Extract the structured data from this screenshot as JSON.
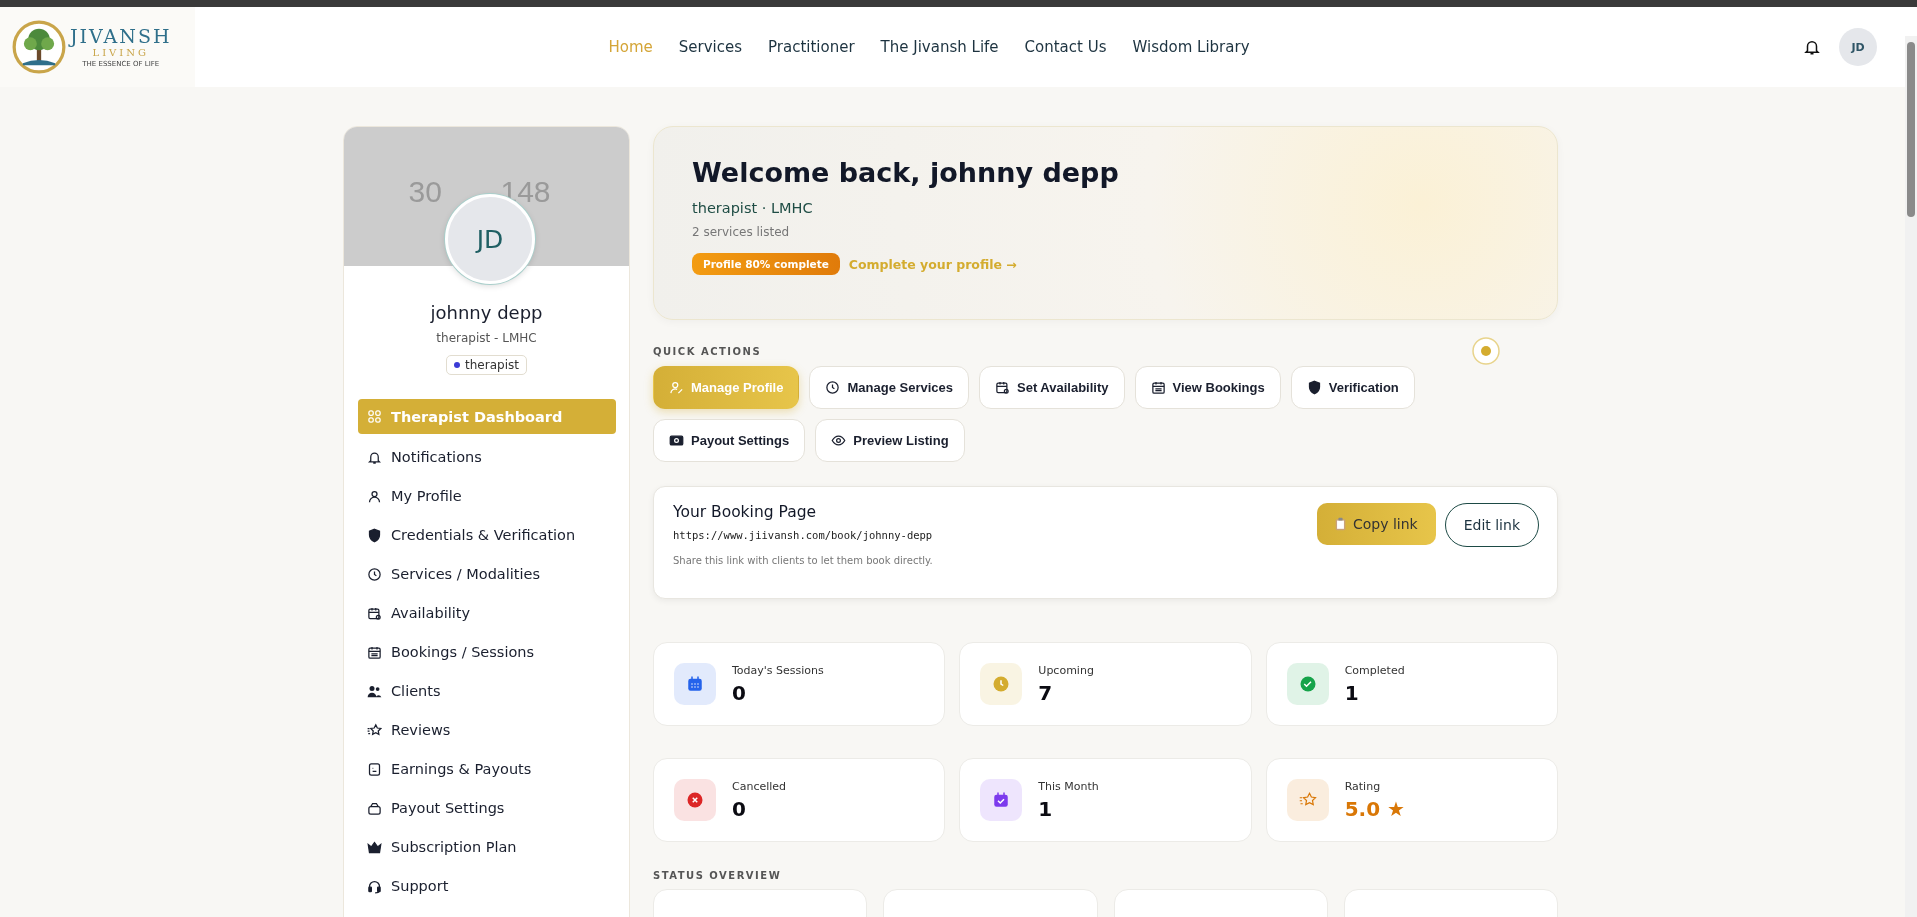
{
  "logo": {
    "name": "JIVANSH",
    "sub": "LIVING",
    "tagline": "THE ESSENCE OF LIFE"
  },
  "nav": [
    {
      "label": "Home",
      "selected": true
    },
    {
      "label": "Services",
      "selected": false
    },
    {
      "label": "Practitioner",
      "selected": false
    },
    {
      "label": "The Jivansh Life",
      "selected": false
    },
    {
      "label": "Contact Us",
      "selected": false
    },
    {
      "label": "Wisdom Library",
      "selected": false
    }
  ],
  "header_avatar": "JD",
  "profile": {
    "cover_text": [
      "30",
      "148"
    ],
    "initials": "JD",
    "name": "johnny depp",
    "subtitle": "therapist - LMHC",
    "role_tag": "therapist"
  },
  "sidebar": [
    {
      "label": "Therapist Dashboard",
      "selected": true
    },
    {
      "label": "Notifications",
      "selected": false
    },
    {
      "label": "My Profile",
      "selected": false
    },
    {
      "label": "Credentials & Verification",
      "selected": false
    },
    {
      "label": "Services / Modalities",
      "selected": false
    },
    {
      "label": "Availability",
      "selected": false
    },
    {
      "label": "Bookings / Sessions",
      "selected": false
    },
    {
      "label": "Clients",
      "selected": false
    },
    {
      "label": "Reviews",
      "selected": false
    },
    {
      "label": "Earnings & Payouts",
      "selected": false
    },
    {
      "label": "Payout Settings",
      "selected": false
    },
    {
      "label": "Subscription Plan",
      "selected": false
    },
    {
      "label": "Support",
      "selected": false
    }
  ],
  "hero": {
    "title": "Welcome back, johnny depp",
    "subtitle": "therapist · LMHC",
    "services": "2 services listed",
    "progress_badge": "Profile 80% complete",
    "progress_link": "Complete your profile →"
  },
  "quick_actions": {
    "heading": "QUICK ACTIONS",
    "buttons": [
      {
        "label": "Manage Profile",
        "selected": true
      },
      {
        "label": "Manage Services",
        "selected": false
      },
      {
        "label": "Set Availability",
        "selected": false
      },
      {
        "label": "View Bookings",
        "selected": false
      },
      {
        "label": "Verification",
        "selected": false
      },
      {
        "label": "Payout Settings",
        "selected": false
      },
      {
        "label": "Preview Listing",
        "selected": false
      }
    ]
  },
  "booking": {
    "title": "Your Booking Page",
    "url": "https://www.jiivansh.com/book/johnny-depp",
    "hint": "Share this link with clients to let them book directly.",
    "copy_button": "Copy link",
    "edit_button": "Edit link"
  },
  "stats": [
    {
      "label": "Today's Sessions",
      "value": "0",
      "color": "#2563eb"
    },
    {
      "label": "Upcoming",
      "value": "7",
      "color": "#d4ac2f"
    },
    {
      "label": "Completed",
      "value": "1",
      "color": "#16a34a"
    },
    {
      "label": "Cancelled",
      "value": "0",
      "color": "#dc2626"
    },
    {
      "label": "This Month",
      "value": "1",
      "color": "#7c3aed"
    },
    {
      "label": "Rating",
      "value": "5.0 ★",
      "color": "#d97706"
    }
  ],
  "status_overview": {
    "heading": "STATUS OVERVIEW"
  }
}
